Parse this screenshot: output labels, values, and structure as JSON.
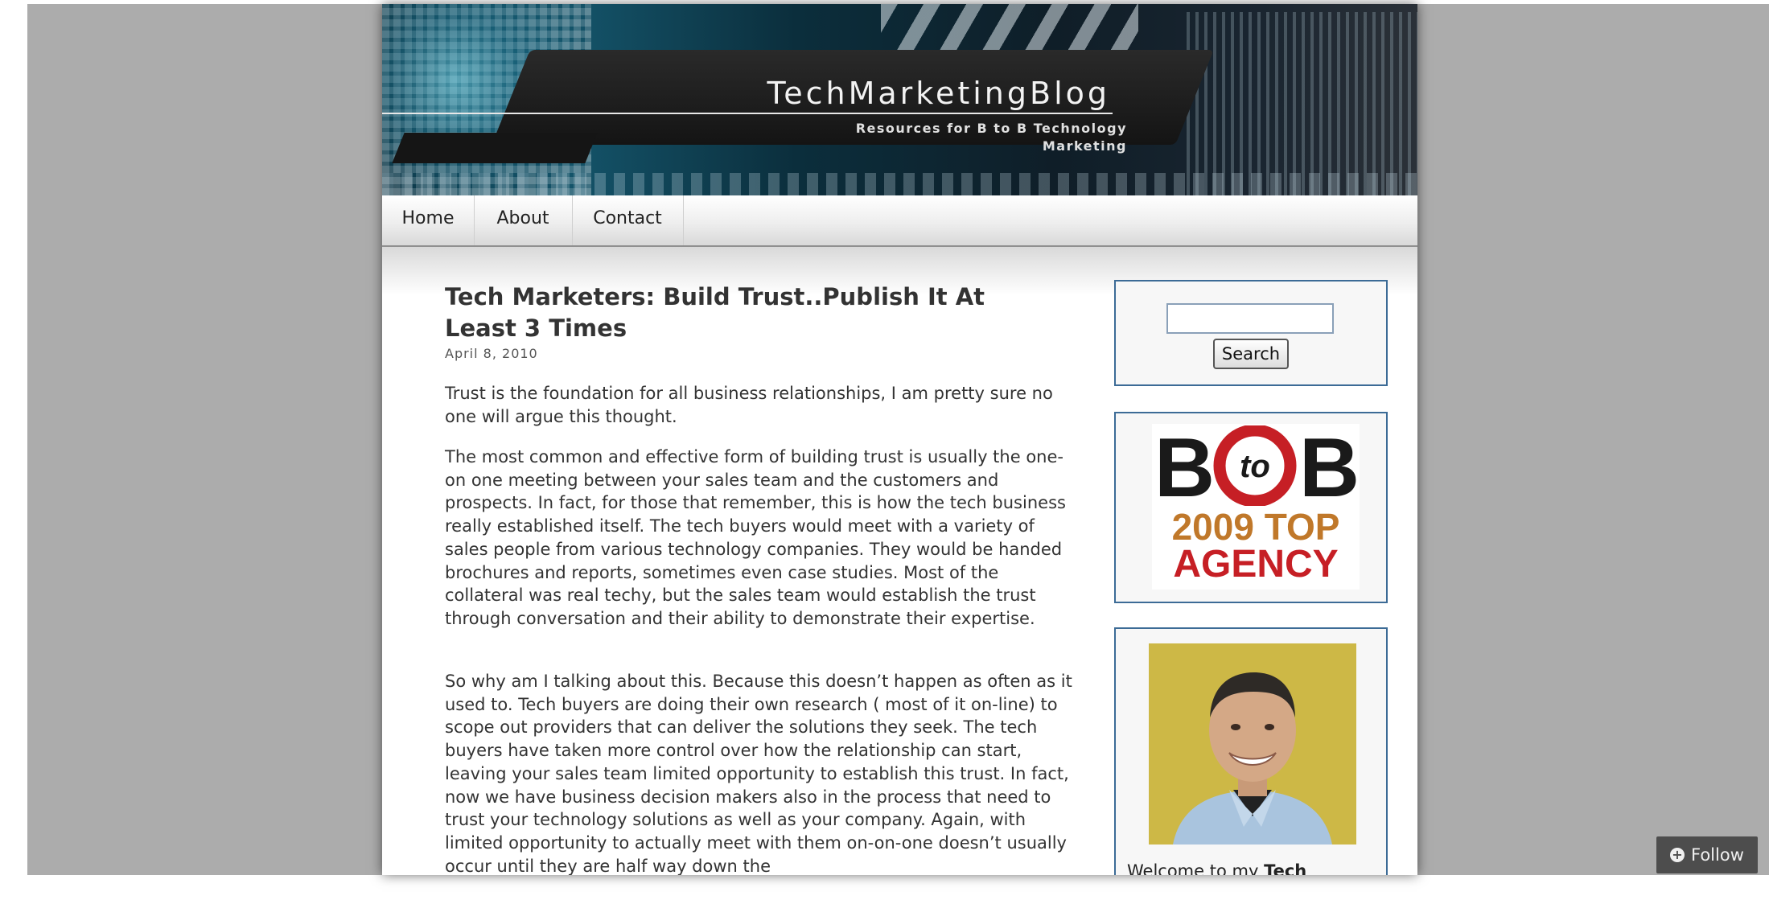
{
  "site": {
    "title": "TechMarketingBlog",
    "tagline": "Resources for B to B Technology Marketing"
  },
  "nav": {
    "items": [
      {
        "label": "Home"
      },
      {
        "label": "About"
      },
      {
        "label": "Contact"
      }
    ]
  },
  "post": {
    "title": "Tech Marketers: Build Trust..Publish It At Least 3 Times",
    "date": "April 8, 2010",
    "paragraphs": [
      "Trust is the foundation for all business relationships, I am pretty sure no one will argue this thought.",
      "The most common and effective form of building trust is usually the one-on one meeting between your sales team and the customers and prospects. In fact, for those that remember, this is how the tech business really established itself. The tech buyers would meet with a variety of sales people from various technology companies. They would be handed brochures and reports, sometimes even case studies. Most of the collateral was real techy, but the sales team would establish the trust through conversation and their ability to demonstrate their expertise.",
      "So why am I talking about this. Because this doesn’t happen as often as it used to. Tech buyers are doing their own research ( most of it on-line) to scope out providers that can deliver the solutions they seek. The tech buyers have taken more control over how the relationship can start, leaving your sales team limited opportunity to establish this trust. In fact, now we have business decision makers also in the process that need to trust your technology solutions as well as your company. Again, with limited opportunity to actually meet with them on-on-one doesn’t usually occur until they are half way down the"
    ]
  },
  "sidebar": {
    "search": {
      "input_value": "",
      "button_label": "Search"
    },
    "badge": {
      "letters_left": "B",
      "circle_text": "to",
      "letters_right": "B",
      "year_line": "2009 TOP",
      "tag_line": "AGENCY",
      "colors": {
        "black": "#1a1a1a",
        "red": "#c61f25",
        "orange": "#c0782a"
      }
    },
    "profile": {
      "welcome_prefix": "Welcome to my ",
      "welcome_bold": "Tech"
    }
  },
  "follow": {
    "label": "Follow",
    "icon": "plus-circle-icon"
  },
  "colors": {
    "page_background": "#acacac",
    "widget_border": "#3c6b96",
    "follow_background": "#4d4d4d"
  }
}
